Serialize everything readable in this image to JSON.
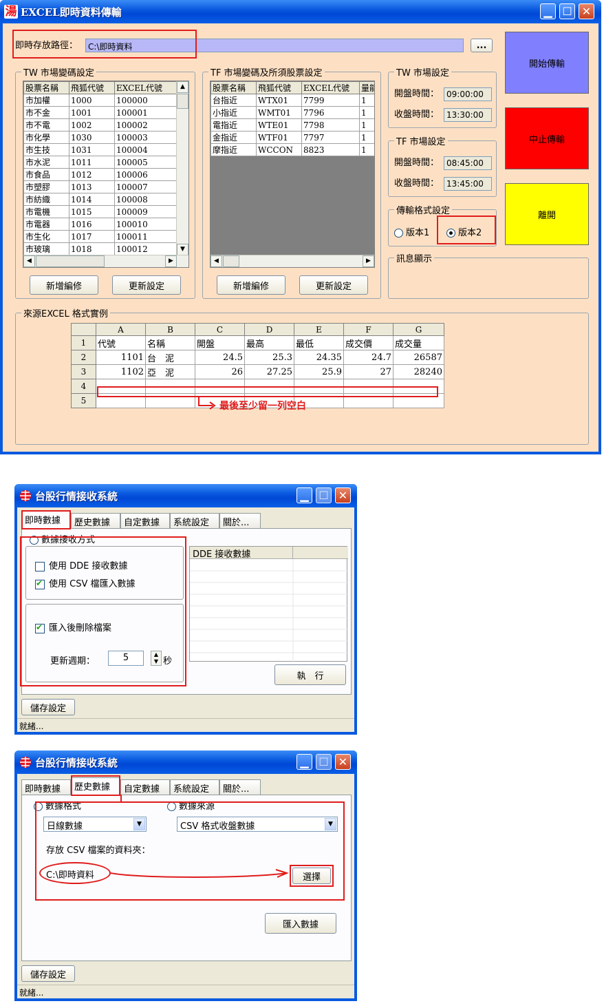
{
  "win1": {
    "icon": "湯",
    "title": "EXCEL即時資料傳輸",
    "path_label": "即時存放路徑：",
    "path_value": "C:\\即時資料",
    "browse_label": "...",
    "tw_group": "TW 市場變碼設定",
    "tw_columns": [
      "股票名稱",
      "飛狐代號",
      "EXCEL代號"
    ],
    "tw_rows": [
      [
        "市加權",
        "1000",
        "100000"
      ],
      [
        "市不金",
        "1001",
        "100001"
      ],
      [
        "市不電",
        "1002",
        "100002"
      ],
      [
        "市化學",
        "1030",
        "100003"
      ],
      [
        "市生技",
        "1031",
        "100004"
      ],
      [
        "市水泥",
        "1011",
        "100005"
      ],
      [
        "市食品",
        "1012",
        "100006"
      ],
      [
        "市塑膠",
        "1013",
        "100007"
      ],
      [
        "市紡織",
        "1014",
        "100008"
      ],
      [
        "市電機",
        "1015",
        "100009"
      ],
      [
        "市電器",
        "1016",
        "100010"
      ],
      [
        "市生化",
        "1017",
        "100011"
      ],
      [
        "市玻璃",
        "1018",
        "100012"
      ]
    ],
    "tf_group": "TF 市場變碼及所須股票設定",
    "tf_columns": [
      "股票名稱",
      "飛狐代號",
      "EXCEL代號",
      "量能"
    ],
    "tf_rows": [
      [
        "台指近",
        "WTX01",
        "7799",
        "1"
      ],
      [
        "小指近",
        "WMT01",
        "7796",
        "1"
      ],
      [
        "電指近",
        "WTE01",
        "7798",
        "1"
      ],
      [
        "金指近",
        "WTF01",
        "7797",
        "1"
      ],
      [
        "摩指近",
        "WCCON",
        "8823",
        "1"
      ]
    ],
    "add_edit_label": "新增編修",
    "update_label": "更新設定",
    "tw_market": {
      "legend": "TW 市場設定",
      "open_label": "開盤時間：",
      "open_value": "09:00:00",
      "close_label": "收盤時間：",
      "close_value": "13:30:00"
    },
    "tf_market": {
      "legend": "TF 市場設定",
      "open_label": "開盤時間：",
      "open_value": "08:45:00",
      "close_label": "收盤時間：",
      "close_value": "13:45:00"
    },
    "format_group": "傳輸格式設定",
    "version1": "版本1",
    "version2": "版本2",
    "start_label": "開始傳輸",
    "stop_label": "中止傳輸",
    "exit_label": "離開",
    "message_group": "訊息顯示",
    "example_group": "來源EXCEL 格式實例",
    "excel_cols": [
      "A",
      "B",
      "C",
      "D",
      "E",
      "F",
      "G"
    ],
    "excel_rows": [
      {
        "num": "1",
        "cells": [
          "代號",
          "名稱",
          "開盤",
          "最高",
          "最低",
          "成交價",
          "成交量"
        ]
      },
      {
        "num": "2",
        "cells": [
          "1101",
          "台　泥",
          "24.5",
          "25.3",
          "24.35",
          "24.7",
          "26587"
        ]
      },
      {
        "num": "3",
        "cells": [
          "1102",
          "亞　泥",
          "26",
          "27.25",
          "25.9",
          "27",
          "28240"
        ]
      },
      {
        "num": "4",
        "cells": [
          "",
          "",
          "",
          "",
          "",
          "",
          ""
        ]
      },
      {
        "num": "5",
        "cells": [
          "",
          "",
          "",
          "",
          "",
          "",
          ""
        ]
      }
    ],
    "annotation": "最後至少留一列空白",
    "colors": {
      "start": "#8080ff",
      "stop": "#ff0000",
      "exit": "#ffff00",
      "body": "#fde0c4"
    }
  },
  "win2": {
    "title": "台股行情接收系統",
    "tabs": [
      "即時數據",
      "歷史數據",
      "自定數據",
      "系統設定",
      "關於..."
    ],
    "method_label": "數據接收方式",
    "use_dde": "使用 DDE 接收數據",
    "use_csv": "使用 CSV 檔匯入數據",
    "delete_after": "匯入後刪除檔案",
    "period_label": "更新週期：",
    "period_value": "5",
    "period_unit": "秒",
    "dde_header": "DDE 接收數據",
    "run_label": "執　行",
    "save_label": "儲存設定",
    "status": "就緒..."
  },
  "win3": {
    "title": "台股行情接收系統",
    "tabs": [
      "即時數據",
      "歷史數據",
      "自定數據",
      "系統設定",
      "關於..."
    ],
    "format_label": "數據格式",
    "format_value": "日線數據",
    "source_label": "數據來源",
    "source_value": "CSV 格式收盤數據",
    "folder_label": "存放 CSV 檔案的資料夾：",
    "folder_value": "C:\\即時資料",
    "choose_label": "選擇",
    "import_label": "匯入數據",
    "save_label": "儲存設定",
    "status": "就緒..."
  }
}
